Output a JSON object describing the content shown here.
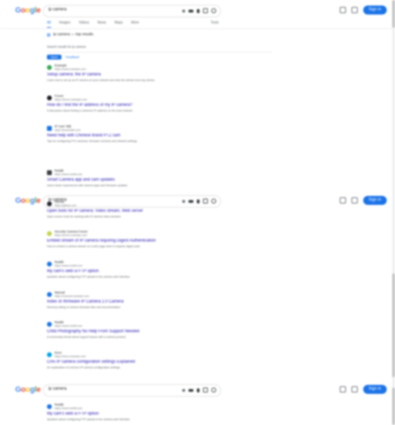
{
  "header": {
    "logo_letters": [
      "G",
      "o",
      "o",
      "g",
      "l",
      "e"
    ],
    "logo_colors": [
      "#4285f4",
      "#ea4335",
      "#fbbc05",
      "#4285f4",
      "#34a853",
      "#ea4335"
    ],
    "search_value": "ip camera",
    "signin_label": "Sign in",
    "icons": [
      "clear-icon",
      "keyboard-icon",
      "mic-icon",
      "lens-icon",
      "search-icon",
      "settings-icon",
      "apps-icon"
    ]
  },
  "tabs": [
    "All",
    "Images",
    "Videos",
    "News",
    "Maps",
    "More"
  ],
  "tools_label": "Tools",
  "snippet": {
    "title": "ip camera — top results",
    "text": "Search results for ip camera",
    "primary_action": "Open",
    "secondary_action": "Feedback"
  },
  "results": [
    {
      "site": "Example",
      "url": "https://www.example.com",
      "title": "Setup camera: the IP camera",
      "snippet": "Learn how to set up an IP camera on your network and view the stream from any device."
    },
    {
      "site": "Forum",
      "url": "https://forum.example.com",
      "title": "How do I find the IP address of my IP camera?",
      "snippet": "A discussion about finding a camera's IP address on the local network."
    },
    {
      "site": "IP Cam Talk",
      "url": "https://ipcamtalk.com",
      "title": "Need help with Chinese brand PTZ cam",
      "snippet": "Tips for configuring PTZ cameras, firmware versions and network settings."
    },
    {
      "site": "Reddit",
      "url": "https://www.reddit.com",
      "title": "Smart Camera app and cam updates",
      "snippet": "Users share experiences with camera apps and firmware updates."
    }
  ],
  "results_page2": [
    {
      "site": "GitHub",
      "url": "https://github.com",
      "title": "Open tools for IP camera: Video stream, Web server",
      "snippet": "Open source tools for working with IP camera video streams."
    },
    {
      "site": "Security Camera Forum",
      "url": "https://forum.example.com",
      "title": "Embed stream of IP camera requiring Digest Authentication",
      "snippet": "How to embed a camera stream on a web page when it requires digest auth."
    },
    {
      "site": "Reddit",
      "url": "https://www.reddit.com",
      "title": "My cam's web ui FTP option",
      "snippet": "Question about configuring FTP upload in the camera web interface."
    },
    {
      "site": "Manual",
      "url": "https://manual.example.com",
      "title": "Index of /firmware IP Camera 2.0 Camera",
      "snippet": "Directory listing of camera firmware files and documentation."
    },
    {
      "site": "Reddit",
      "url": "https://www.reddit.com",
      "title": "Child Photography No Help From Support Needed",
      "snippet": "A community thread about support issues with a camera product."
    },
    {
      "site": "Docs",
      "url": "https://docs.example.com",
      "title": "Cms IP camera configuration settings Explained",
      "snippet": "An explanation of common IP camera configuration settings."
    }
  ],
  "results_page3": [
    {
      "site": "Reddit",
      "url": "https://www.reddit.com",
      "title": "My cam's web ui FTP option",
      "snippet": "Question about configuring FTP upload in the camera web interface."
    }
  ]
}
